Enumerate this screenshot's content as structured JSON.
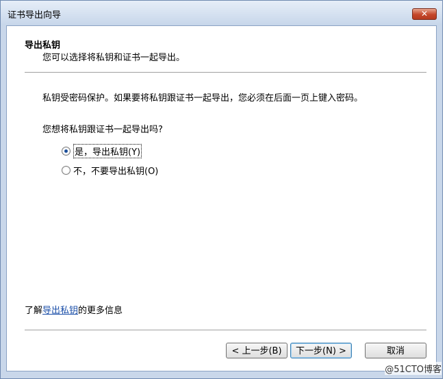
{
  "window": {
    "title": "证书导出向导",
    "close_label": "✕"
  },
  "header": {
    "title": "导出私钥",
    "subtitle": "您可以选择将私钥和证书一起导出。"
  },
  "body": {
    "description": "私钥受密码保护。如果要将私钥跟证书一起导出，您必须在后面一页上键入密码。",
    "question": "您想将私钥跟证书一起导出吗?",
    "options": [
      {
        "label": "是，导出私钥(Y)",
        "checked": true
      },
      {
        "label": "不，不要导出私钥(O)",
        "checked": false
      }
    ]
  },
  "info": {
    "prefix": "了解",
    "link": "导出私钥",
    "suffix": "的更多信息"
  },
  "buttons": {
    "back": "< 上一步(B)",
    "next": "下一步(N) >",
    "cancel": "取消"
  },
  "watermark": "@51CTO博客"
}
